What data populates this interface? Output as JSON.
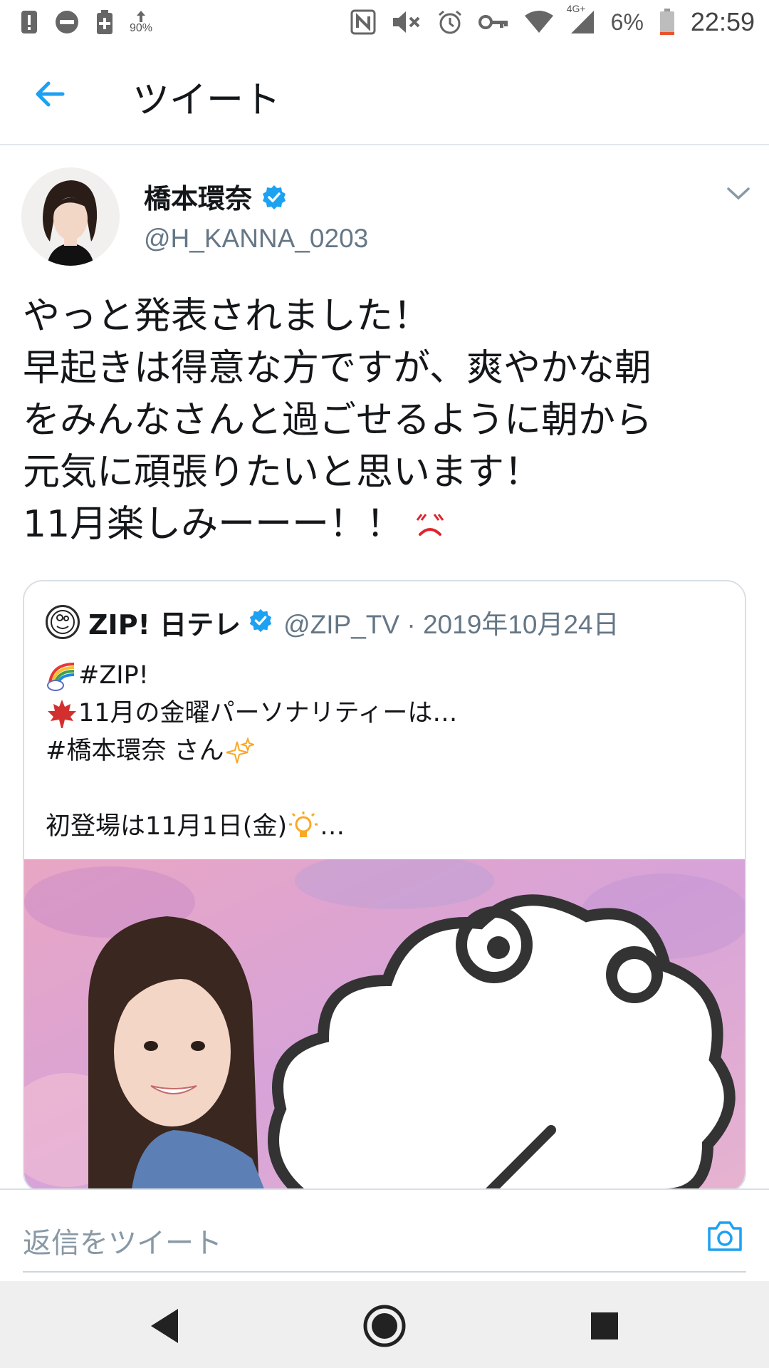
{
  "status_bar": {
    "upload_percent": "90%",
    "network": "4G+",
    "battery": "6%",
    "time": "22:59"
  },
  "app_bar": {
    "title": "ツイート",
    "back_icon": "arrow-left-icon"
  },
  "tweet": {
    "author_name": "橋本環奈",
    "author_handle": "@H_KANNA_0203",
    "verified": true,
    "text": "やっと発表されました！\n早起きは得意な方ですが、爽やかな朝\nをみんなさんと過ごせるように朝から\n元気に頑張りたいと思います！\n11月楽しみーーー！！"
  },
  "quoted_tweet": {
    "author_name": "ZIP! 日テレ",
    "handle_date": "@ZIP_TV · 2019年10月24日",
    "lines": [
      "#ZIP!",
      "11月の金曜パーソナリティーは…",
      "#橋本環奈 さん",
      "",
      "初登場は11月1日(金)",
      "…"
    ]
  },
  "reply_bar": {
    "placeholder": "返信をツイート",
    "camera_icon": "camera-icon"
  },
  "colors": {
    "accent": "#1da1f2",
    "secondary_text": "#657786",
    "divider": "#e1e8ed"
  }
}
